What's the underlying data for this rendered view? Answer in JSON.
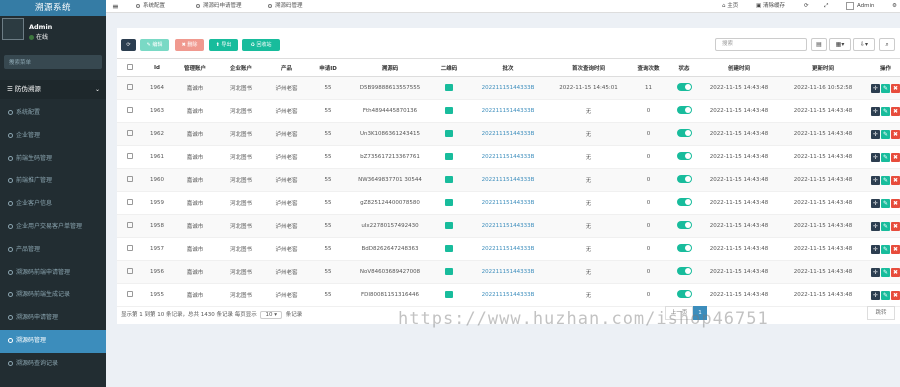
{
  "app": {
    "brand": "溯源系统"
  },
  "user": {
    "name": "Admin",
    "status": "在线"
  },
  "sidebar": {
    "search_placeholder": "搜索菜单",
    "section_label": "防伪溯源",
    "items": [
      {
        "label": "系统配置"
      },
      {
        "label": "企业管理"
      },
      {
        "label": "前端生码管理"
      },
      {
        "label": "前端推广管理"
      },
      {
        "label": "企业客户信息"
      },
      {
        "label": "企业用户交易客户单管理"
      },
      {
        "label": "产品管理"
      },
      {
        "label": "溯源码前端申请管理"
      },
      {
        "label": "溯源码前端生成记录"
      },
      {
        "label": "溯源码申请管理"
      },
      {
        "label": "溯源码管理"
      },
      {
        "label": "溯源码查询记录"
      }
    ]
  },
  "header": {
    "tabs": [
      {
        "label": "系统配置"
      },
      {
        "label": "溯源码申请管理"
      },
      {
        "label": "溯源码管理"
      }
    ],
    "home": "主页",
    "clear_cache": "清除缓存",
    "admin": "Admin"
  },
  "toolbar": {
    "edit": "编辑",
    "delete": "删除",
    "export": "导出",
    "recycle": "回收站",
    "search_placeholder": "搜索"
  },
  "table": {
    "columns": [
      "",
      "Id",
      "管理账户",
      "企业账户",
      "产品",
      "申请ID",
      "溯源码",
      "二维码",
      "批次",
      "首次查询时间",
      "查询次数",
      "状态",
      "创建时间",
      "更新时间",
      "操作"
    ],
    "rows": [
      {
        "id": "1964",
        "manager": "嘉诚市",
        "company": "河北图书",
        "product": "泸州老窖",
        "apply_id": "55",
        "code": "D5B99888613557555",
        "batch": "20221115144333B",
        "first_query": "2022-11-15 14:45:01",
        "count": "11",
        "created": "2022-11-15 14:43:48",
        "updated": "2022-11-16 10:52:58"
      },
      {
        "id": "1963",
        "manager": "嘉诚市",
        "company": "河北图书",
        "product": "泸州老窖",
        "apply_id": "55",
        "code": "Fth4894445870136",
        "batch": "20221115144333B",
        "first_query": "无",
        "count": "0",
        "created": "2022-11-15 14:43:48",
        "updated": "2022-11-15 14:43:48"
      },
      {
        "id": "1962",
        "manager": "嘉诚市",
        "company": "河北图书",
        "product": "泸州老窖",
        "apply_id": "55",
        "code": "Un3K1086361243415",
        "batch": "20221115144333B",
        "first_query": "无",
        "count": "0",
        "created": "2022-11-15 14:43:48",
        "updated": "2022-11-15 14:43:48"
      },
      {
        "id": "1961",
        "manager": "嘉诚市",
        "company": "河北图书",
        "product": "泸州老窖",
        "apply_id": "55",
        "code": "bZ735617213367761",
        "batch": "20221115144333B",
        "first_query": "无",
        "count": "0",
        "created": "2022-11-15 14:43:48",
        "updated": "2022-11-15 14:43:48"
      },
      {
        "id": "1960",
        "manager": "嘉诚市",
        "company": "河北图书",
        "product": "泸州老窖",
        "apply_id": "55",
        "code": "NW3649837701 30544",
        "batch": "20221115144333B",
        "first_query": "无",
        "count": "0",
        "created": "2022-11-15 14:43:48",
        "updated": "2022-11-15 14:43:48"
      },
      {
        "id": "1959",
        "manager": "嘉诚市",
        "company": "河北图书",
        "product": "泸州老窖",
        "apply_id": "55",
        "code": "gZ825124400078580",
        "batch": "20221115144333B",
        "first_query": "无",
        "count": "0",
        "created": "2022-11-15 14:43:48",
        "updated": "2022-11-15 14:43:48"
      },
      {
        "id": "1958",
        "manager": "嘉诚市",
        "company": "河北图书",
        "product": "泸州老窖",
        "apply_id": "55",
        "code": "uIx22780157492430",
        "batch": "20221115144333B",
        "first_query": "无",
        "count": "0",
        "created": "2022-11-15 14:43:48",
        "updated": "2022-11-15 14:43:48"
      },
      {
        "id": "1957",
        "manager": "嘉诚市",
        "company": "河北图书",
        "product": "泸州老窖",
        "apply_id": "55",
        "code": "BdD8262647248363",
        "batch": "20221115144333B",
        "first_query": "无",
        "count": "0",
        "created": "2022-11-15 14:43:48",
        "updated": "2022-11-15 14:43:48"
      },
      {
        "id": "1956",
        "manager": "嘉诚市",
        "company": "河北图书",
        "product": "泸州老窖",
        "apply_id": "55",
        "code": "NoV84603689427008",
        "batch": "20221115144333B",
        "first_query": "无",
        "count": "0",
        "created": "2022-11-15 14:43:48",
        "updated": "2022-11-15 14:43:48"
      },
      {
        "id": "1955",
        "manager": "嘉诚市",
        "company": "河北图书",
        "product": "泸州老窖",
        "apply_id": "55",
        "code": "FDI80081151316446",
        "batch": "20221115144333B",
        "first_query": "无",
        "count": "0",
        "created": "2022-11-15 14:43:48",
        "updated": "2022-11-15 14:43:48"
      }
    ]
  },
  "footer": {
    "range_text": "显示第 1 到第 10 条记录，总共 1430 条记录 每页显示",
    "page_size": "10",
    "suffix": "条记录"
  },
  "pagination": {
    "prev": "上一页",
    "current": "1",
    "jump": "跳转"
  },
  "watermark": "https://www.huzhan.com/ishop46751",
  "colors": {
    "sidebar": "#222d32",
    "brand": "#357ca5",
    "active": "#3c8dbc",
    "success": "#18bc9c",
    "danger": "#e74c3c"
  }
}
